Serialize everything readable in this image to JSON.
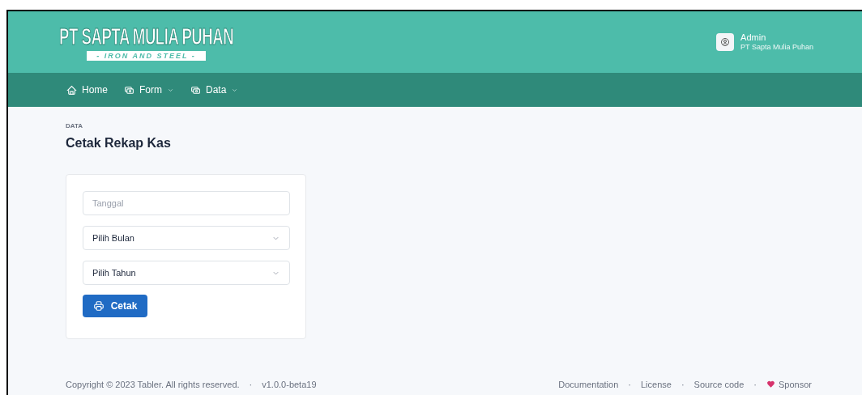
{
  "logo": {
    "title": "PT SAPTA MULIA PUHAN",
    "subtitle": "- IRON AND STEEL -"
  },
  "user": {
    "name": "Admin",
    "company": "PT Sapta Mulia Puhan"
  },
  "nav": [
    {
      "label": "Home",
      "kind": "home",
      "dropdown": false
    },
    {
      "label": "Form",
      "kind": "menu",
      "dropdown": true
    },
    {
      "label": "Data",
      "kind": "menu",
      "dropdown": true
    }
  ],
  "page": {
    "pretitle": "DATA",
    "title": "Cetak Rekap Kas"
  },
  "form": {
    "fields": [
      {
        "kind": "input",
        "placeholder": "Tanggal"
      },
      {
        "kind": "select",
        "value": "Pilih Bulan"
      },
      {
        "kind": "select",
        "value": "Pilih Tahun"
      }
    ],
    "button": "Cetak"
  },
  "footer": {
    "left": [
      {
        "text": "Copyright © 2023 Tabler. All rights reserved.",
        "kind": "text"
      },
      {
        "text": "·",
        "kind": "separator"
      },
      {
        "text": "v1.0.0-beta19",
        "kind": "text"
      }
    ],
    "links": [
      {
        "label": "Documentation",
        "kind": "link"
      },
      {
        "label": "·",
        "kind": "separator"
      },
      {
        "label": "License",
        "kind": "link"
      },
      {
        "label": "·",
        "kind": "separator"
      },
      {
        "label": "Source code",
        "kind": "link"
      },
      {
        "label": "·",
        "kind": "separator"
      },
      {
        "label": "Sponsor",
        "kind": "sponsor"
      }
    ]
  }
}
